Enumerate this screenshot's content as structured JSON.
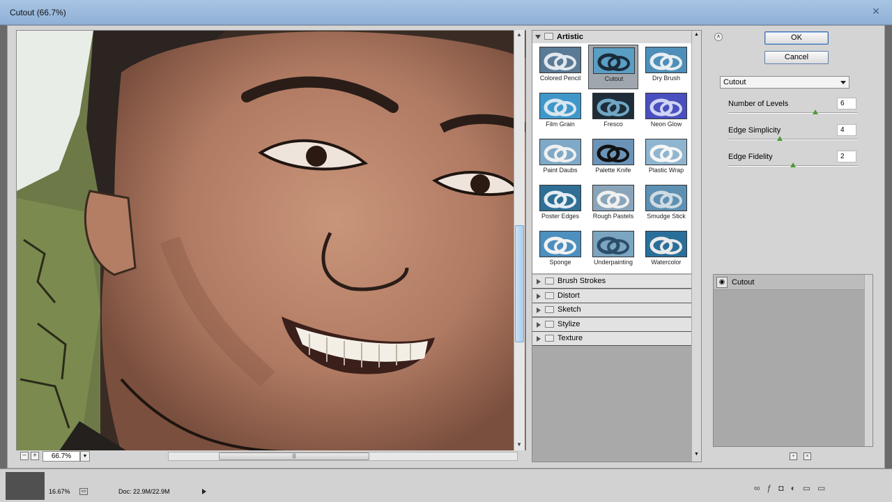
{
  "window": {
    "title": "Cutout (66.7%)",
    "close_glyph": "✕"
  },
  "preview": {
    "zoom": "66.7%",
    "zoom_minus": "−",
    "zoom_plus": "+"
  },
  "gallery": {
    "open_category": "Artistic",
    "artistic_filters": [
      {
        "label": "Colored Pencil",
        "selected": false
      },
      {
        "label": "Cutout",
        "selected": true
      },
      {
        "label": "Dry Brush",
        "selected": false
      },
      {
        "label": "Film Grain",
        "selected": false
      },
      {
        "label": "Fresco",
        "selected": false
      },
      {
        "label": "Neon Glow",
        "selected": false
      },
      {
        "label": "Paint Daubs",
        "selected": false
      },
      {
        "label": "Palette Knife",
        "selected": false
      },
      {
        "label": "Plastic Wrap",
        "selected": false
      },
      {
        "label": "Poster Edges",
        "selected": false
      },
      {
        "label": "Rough Pastels",
        "selected": false
      },
      {
        "label": "Smudge Stick",
        "selected": false
      },
      {
        "label": "Sponge",
        "selected": false
      },
      {
        "label": "Underpainting",
        "selected": false
      },
      {
        "label": "Watercolor",
        "selected": false
      }
    ],
    "categories": [
      "Brush Strokes",
      "Distort",
      "Sketch",
      "Stylize",
      "Texture"
    ]
  },
  "controls": {
    "ok_label": "OK",
    "cancel_label": "Cancel",
    "filter_select": "Cutout",
    "params": [
      {
        "label": "Number of Levels",
        "value": "6",
        "level": 0.67
      },
      {
        "label": "Edge Simplicity",
        "value": "4",
        "level": 0.4
      },
      {
        "label": "Edge Fidelity",
        "value": "2",
        "level": 0.5
      }
    ]
  },
  "effect_layers": [
    {
      "name": "Cutout"
    }
  ],
  "status": {
    "zoom": "16.67%",
    "doc": "Doc: 22.9M/22.9M"
  },
  "colors": {
    "accent": "#3e6fb0",
    "title_bar": "#a8c4e4",
    "slider_knob": "#4c9a36"
  }
}
